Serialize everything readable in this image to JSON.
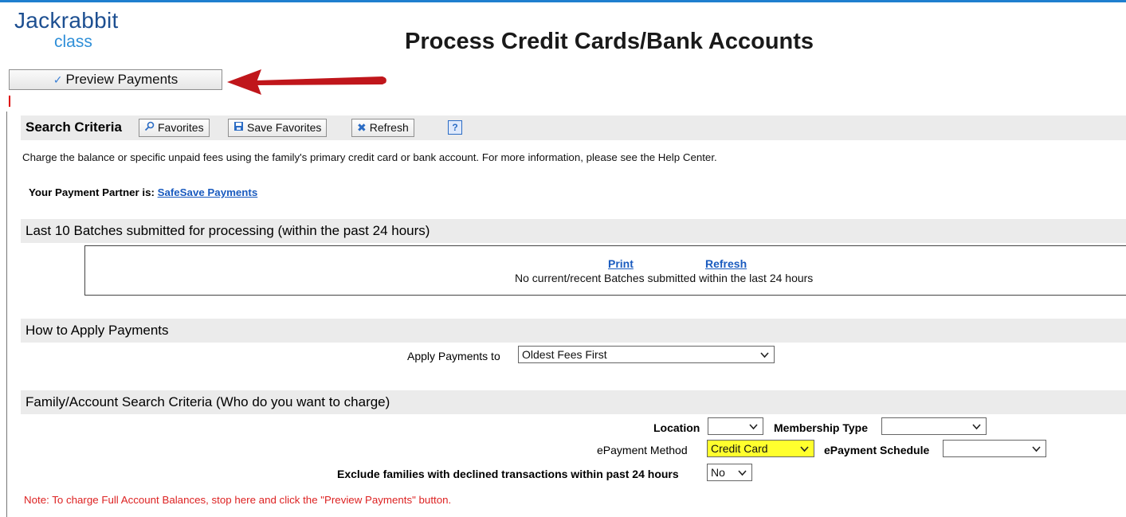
{
  "logo": {
    "line1": "Jackrabbit",
    "line2": "class"
  },
  "page_title": "Process Credit Cards/Bank Accounts",
  "preview_button": {
    "label": "Preview Payments"
  },
  "search_criteria": {
    "title": "Search Criteria",
    "favorites_label": "Favorites",
    "save_favorites_label": "Save Favorites",
    "refresh_label": "Refresh",
    "help_label": "?"
  },
  "description": "Charge the balance or specific unpaid fees using the family's primary credit card or bank account. For more information, please see the Help Center.",
  "partner": {
    "label": "Your Payment Partner is:",
    "link": "SafeSave Payments"
  },
  "batches": {
    "title": "Last 10 Batches submitted for processing (within the past 24 hours)",
    "print_label": "Print",
    "refresh_label": "Refresh",
    "message": "No current/recent Batches submitted within the last 24 hours"
  },
  "apply": {
    "title": "How to Apply Payments",
    "label": "Apply Payments to",
    "value": "Oldest Fees First"
  },
  "family": {
    "title": "Family/Account Search Criteria (Who do you want to charge)",
    "location_label": "Location",
    "location_value": "",
    "membership_label": "Membership Type",
    "membership_value": "",
    "epayment_method_label": "ePayment Method",
    "epayment_method_value": "Credit Card",
    "epayment_schedule_label": "ePayment Schedule",
    "epayment_schedule_value": "",
    "exclude_label": "Exclude families with declined transactions within past 24 hours",
    "exclude_value": "No"
  },
  "note": "Note:  To charge Full Account Balances, stop here and click the \"Preview Payments\" button.",
  "colors": {
    "accent": "#1f7fcf",
    "arrow": "#c0161b",
    "highlight": "#ffff2e",
    "note": "#d22222"
  }
}
